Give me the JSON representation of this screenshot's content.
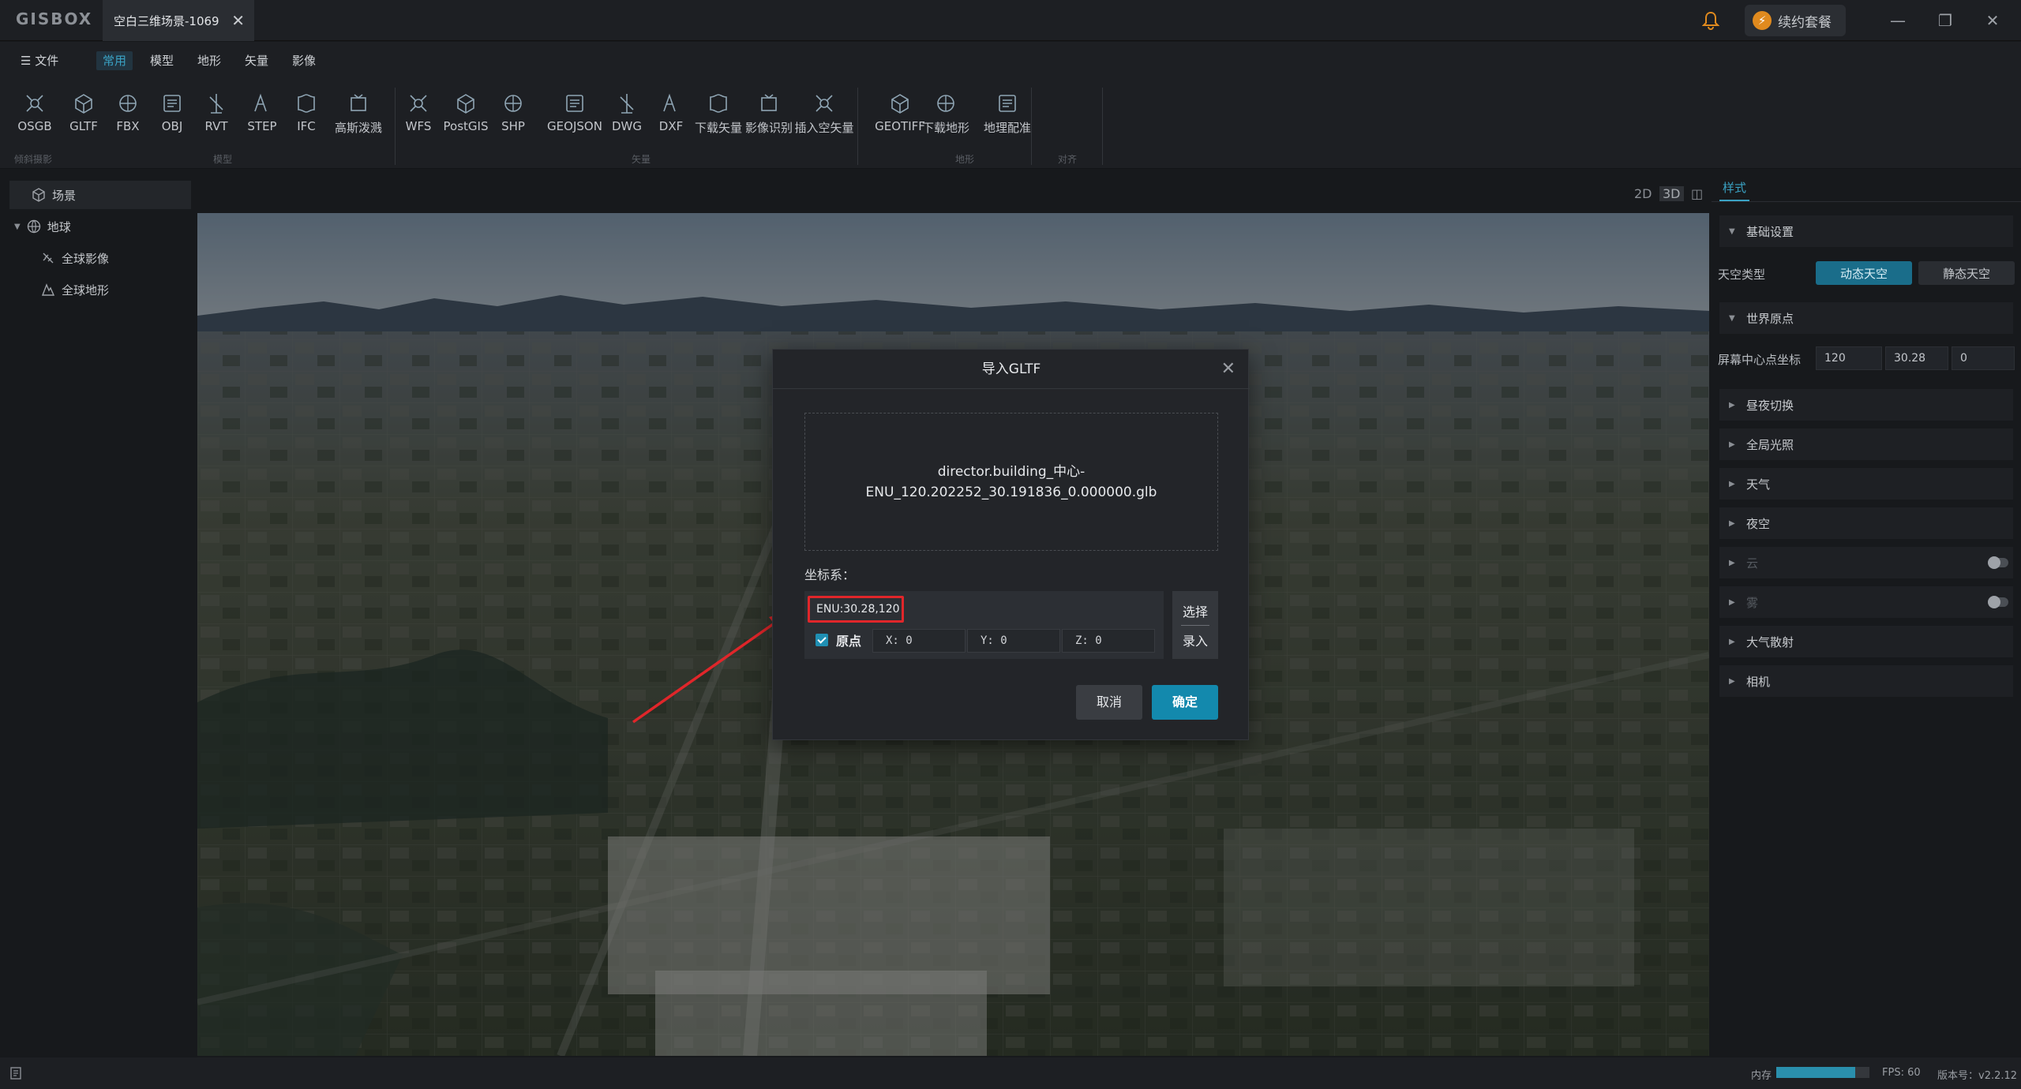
{
  "app": {
    "logo": "GISBOX",
    "document_tab": "空白三维场景-1069",
    "renew_label": "续约套餐",
    "renew_icon": "lightning-icon"
  },
  "menu": {
    "file": "文件",
    "tabs": [
      {
        "label": "常用",
        "active": true
      },
      {
        "label": "模型"
      },
      {
        "label": "地形"
      },
      {
        "label": "矢量"
      },
      {
        "label": "影像"
      }
    ]
  },
  "ribbon": {
    "items": [
      "OSGB",
      "GLTF",
      "FBX",
      "OBJ",
      "RVT",
      "STEP",
      "IFC",
      "高斯泼溅",
      "WFS",
      "PostGIS",
      "SHP",
      "GEOJSON",
      "DWG",
      "DXF",
      "下载矢量",
      "影像识别",
      "插入空矢量",
      "GEOTIFF",
      "下载地形",
      "地理配准"
    ],
    "groups": [
      "倾斜摄影",
      "模型",
      "矢量",
      "地形",
      "对齐"
    ]
  },
  "scene_tree": {
    "root": "场景",
    "earth": "地球",
    "imagery": "全球影像",
    "terrain": "全球地形"
  },
  "view_modes": [
    "2D",
    "3D"
  ],
  "panel": {
    "tab": "样式",
    "basic": "基础设置",
    "sky_type_label": "天空类型",
    "sky_dynamic": "动态天空",
    "sky_static": "静态天空",
    "world_origin": "世界原点",
    "screen_center_label": "屏幕中心点坐标",
    "screen_center": [
      "120",
      "30.28",
      "0"
    ],
    "sections": [
      "昼夜切换",
      "全局光照",
      "天气",
      "夜空",
      "云",
      "雾",
      "大气散射",
      "相机"
    ]
  },
  "dialog": {
    "title": "导入GLTF",
    "file_line1": "director.building_中心-",
    "file_line2": "ENU_120.202252_30.191836_0.000000.glb",
    "crs_label": "坐标系：",
    "crs_value": "ENU:30.28,120",
    "origin_label": "原点",
    "x": "X: 0",
    "y": "Y: 0",
    "z": "Z: 0",
    "pick_select": "选择",
    "pick_input": "录入",
    "cancel": "取消",
    "ok": "确定"
  },
  "status": {
    "memory_label": "内存",
    "memory_fraction": 0.85,
    "fps": "FPS: 60",
    "version": "版本号：v2.2.12"
  },
  "colors": {
    "accent": "#1389ad",
    "highlight": "#e0262a",
    "bg": "#17191c"
  }
}
